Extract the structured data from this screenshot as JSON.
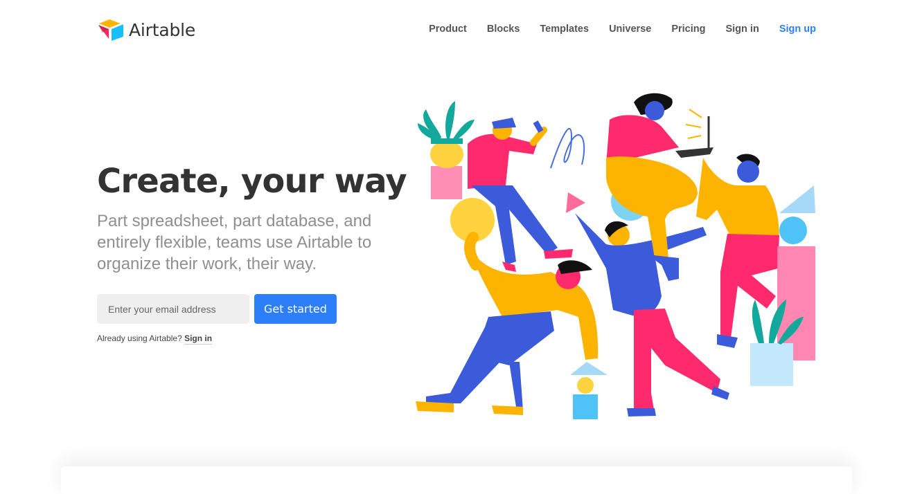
{
  "brand": {
    "name": "Airtable"
  },
  "nav": {
    "items": [
      {
        "label": "Product"
      },
      {
        "label": "Blocks"
      },
      {
        "label": "Templates"
      },
      {
        "label": "Universe"
      },
      {
        "label": "Pricing"
      },
      {
        "label": "Sign in"
      }
    ],
    "signup_label": "Sign up"
  },
  "hero": {
    "headline": "Create, your way",
    "subhead": "Part spreadsheet, part database, and entirely flexible, teams use Airtable to organize their work, their way.",
    "email_placeholder": "Enter your email address",
    "cta_label": "Get started",
    "already_text": "Already using Airtable?",
    "already_link": "Sign in"
  },
  "colors": {
    "accent": "#2d7ff9",
    "headline": "#333333",
    "subhead": "#8f8f8f",
    "illustration_pink": "#ff2a6d",
    "illustration_yellow": "#fcb400",
    "illustration_blue": "#3b5bdb",
    "illustration_teal": "#12a89c",
    "illustration_lightblue": "#7fd3f2"
  }
}
